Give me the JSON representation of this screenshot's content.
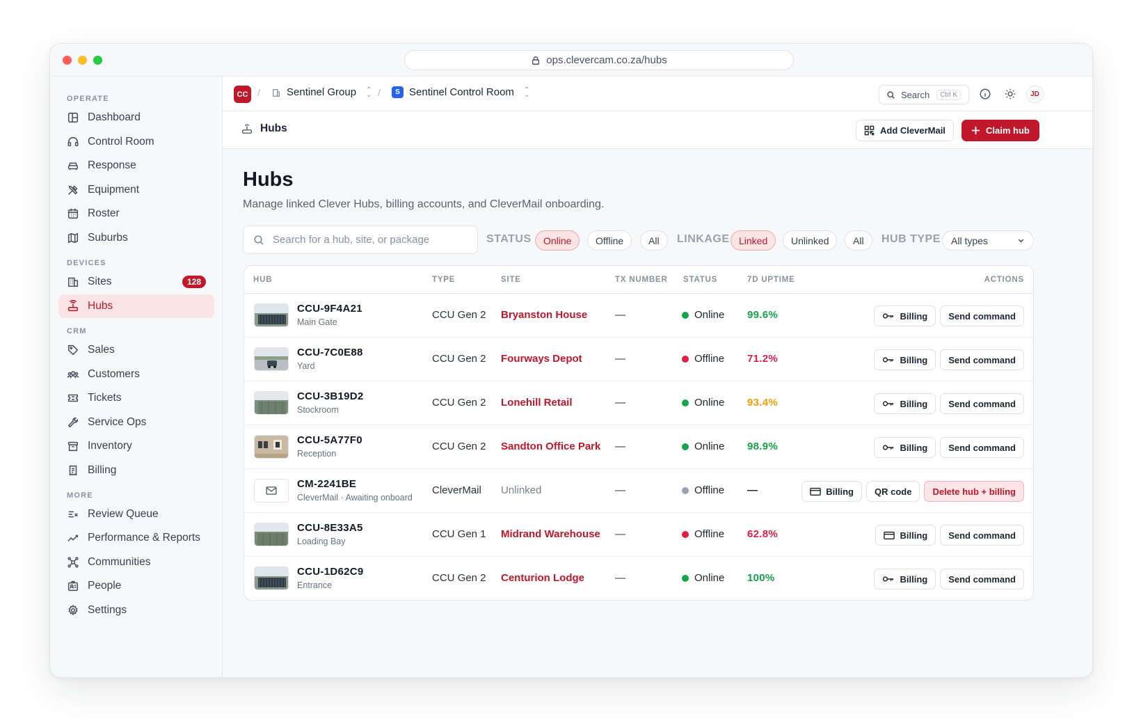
{
  "browser": {
    "url": "ops.clevercam.co.za/hubs"
  },
  "sidebar": {
    "sections": [
      {
        "title": "OPERATE",
        "items": [
          {
            "label": "Dashboard",
            "icon": "dashboard-icon"
          },
          {
            "label": "Control Room",
            "icon": "headset-icon"
          },
          {
            "label": "Response",
            "icon": "car-icon"
          },
          {
            "label": "Equipment",
            "icon": "tools-icon"
          },
          {
            "label": "Roster",
            "icon": "calendar-icon"
          },
          {
            "label": "Suburbs",
            "icon": "map-icon"
          }
        ]
      },
      {
        "title": "DEVICES",
        "items": [
          {
            "label": "Sites",
            "icon": "building-icon",
            "badge": "128"
          },
          {
            "label": "Hubs",
            "icon": "router-icon",
            "active": true
          }
        ]
      },
      {
        "title": "CRM",
        "items": [
          {
            "label": "Sales",
            "icon": "tag-icon"
          },
          {
            "label": "Customers",
            "icon": "users-icon"
          },
          {
            "label": "Tickets",
            "icon": "ticket-icon"
          },
          {
            "label": "Service Ops",
            "icon": "wrench-icon"
          },
          {
            "label": "Inventory",
            "icon": "archive-icon"
          },
          {
            "label": "Billing",
            "icon": "receipt-icon"
          }
        ]
      },
      {
        "title": "MORE",
        "items": [
          {
            "label": "Review Queue",
            "icon": "list-check-icon"
          },
          {
            "label": "Performance & Reports",
            "icon": "chart-line-icon"
          },
          {
            "label": "Communities",
            "icon": "network-icon"
          },
          {
            "label": "People",
            "icon": "id-card-icon"
          },
          {
            "label": "Settings",
            "icon": "gear-icon"
          }
        ]
      }
    ]
  },
  "topbar": {
    "logo": "CC",
    "org": "Sentinel Group",
    "workspace_logo": "S",
    "workspace": "Sentinel Control Room",
    "search_label": "Search",
    "search_shortcut": "Ctrl K",
    "avatar": "JD"
  },
  "pagebar": {
    "crumb": "Hubs",
    "add_clevermail": "Add CleverMail",
    "claim_hub": "Claim hub"
  },
  "page": {
    "title": "Hubs",
    "subtitle": "Manage linked Clever Hubs, billing accounts, and CleverMail onboarding."
  },
  "filters": {
    "search_placeholder": "Search for a hub, site, or package",
    "status_label": "STATUS",
    "status_options": [
      "Online",
      "Offline",
      "All"
    ],
    "status_selected": "Online",
    "linkage_label": "LINKAGE",
    "linkage_options": [
      "Linked",
      "Unlinked",
      "All"
    ],
    "linkage_selected": "Linked",
    "hubtype_label": "HUB TYPE",
    "hubtype_value": "All types"
  },
  "table": {
    "columns": [
      "HUB",
      "TYPE",
      "SITE",
      "TX NUMBER",
      "STATUS",
      "7D UPTIME",
      "ACTIONS"
    ],
    "rows": [
      {
        "id": "CCU-9F4A21",
        "sub": "Main Gate",
        "type": "CCU Gen 2",
        "site": "Bryanston House",
        "tx": "—",
        "status": "Online",
        "uptime": "99.6%",
        "uptime_color": "#16a34a",
        "actions": [
          "Billing",
          "Send command"
        ]
      },
      {
        "id": "CCU-7C0E88",
        "sub": "Yard",
        "type": "CCU Gen 2",
        "site": "Fourways Depot",
        "tx": "—",
        "status": "Offline",
        "uptime": "71.2%",
        "uptime_color": "#e11d48",
        "actions": [
          "Billing",
          "Send command"
        ]
      },
      {
        "id": "CCU-3B19D2",
        "sub": "Stockroom",
        "type": "CCU Gen 2",
        "site": "Lonehill Retail",
        "tx": "—",
        "status": "Online",
        "uptime": "93.4%",
        "uptime_color": "#f59e0b",
        "actions": [
          "Billing",
          "Send command"
        ]
      },
      {
        "id": "CCU-5A77F0",
        "sub": "Reception",
        "type": "CCU Gen 2",
        "site": "Sandton Office Park",
        "tx": "—",
        "status": "Online",
        "uptime": "98.9%",
        "uptime_color": "#16a34a",
        "actions": [
          "Billing",
          "Send command"
        ]
      },
      {
        "id": "CM-2241BE",
        "sub": "CleverMail · Awaiting onboard",
        "type": "CleverMail",
        "site": "Unlinked",
        "tx": "—",
        "status": "Offline",
        "uptime": "—",
        "uptime_color": "#1f2430",
        "actions": [
          "Billing",
          "QR code",
          "Delete hub + billing"
        ]
      },
      {
        "id": "CCU-8E33A5",
        "sub": "Loading Bay",
        "type": "CCU Gen 1",
        "site": "Midrand Warehouse",
        "tx": "—",
        "status": "Offline",
        "uptime": "62.8%",
        "uptime_color": "#e11d48",
        "actions": [
          "Billing",
          "Send command"
        ]
      },
      {
        "id": "CCU-1D62C9",
        "sub": "Entrance",
        "type": "CCU Gen 2",
        "site": "Centurion Lodge",
        "tx": "—",
        "status": "Online",
        "uptime": "100%",
        "uptime_color": "#16a34a",
        "actions": [
          "Billing",
          "Send command"
        ]
      }
    ]
  },
  "colors": {
    "brand": "#c0182a",
    "online": "#16a34a",
    "offline_red": "#e11d48",
    "offline_grey": "#9aa3b2",
    "warning": "#f59e0b"
  }
}
